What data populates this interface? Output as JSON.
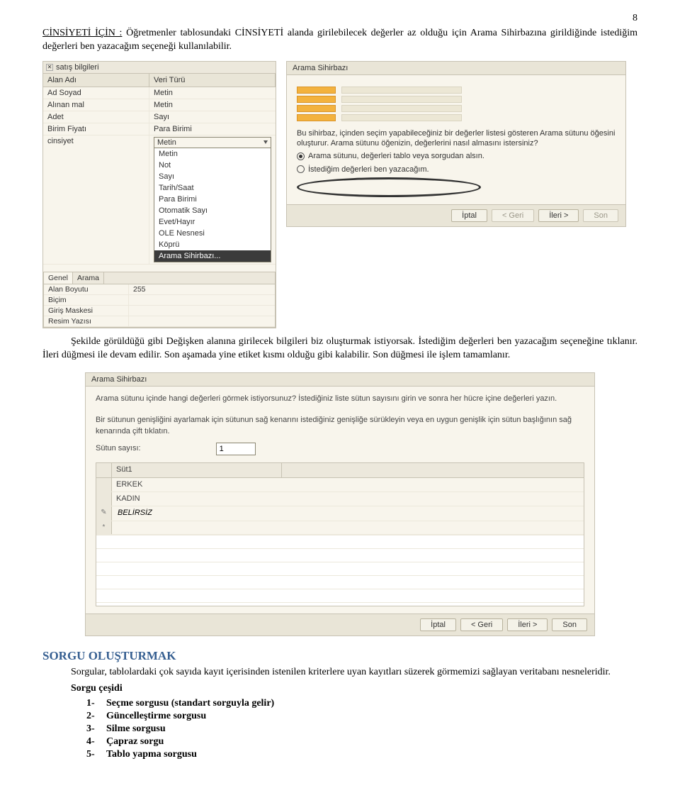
{
  "page_number": "8",
  "intro_prefix": "CİNSİYETİ İÇİN :",
  "intro_text": " Öğretmenler tablosundaki CİNSİYETİ alanda girilebilecek değerler az olduğu için Arama Sihirbazına girildiğinde istediğim değerleri ben yazacağım seçeneği kullanılabilir.",
  "mid_para": "Şekilde görüldüğü gibi Değişken alanına girilecek bilgileri biz oluşturmak istiyorsak. İstediğim değerleri ben yazacağım seçeneğine tıklanır. İleri düğmesi ile devam edilir. Son aşamada yine etiket kısmı olduğu gibi kalabilir. Son düğmesi ile işlem tamamlanır.",
  "left": {
    "tab": "satış bilgileri",
    "head_a": "Alan Adı",
    "head_b": "Veri Türü",
    "rows": [
      {
        "a": "Ad Soyad",
        "b": "Metin"
      },
      {
        "a": "Alınan mal",
        "b": "Metin"
      },
      {
        "a": "Adet",
        "b": "Sayı"
      },
      {
        "a": "Birim Fiyatı",
        "b": "Para Birimi"
      }
    ],
    "active_a": "cinsiyet",
    "active_b": "Metin",
    "dd": [
      "Metin",
      "Not",
      "Sayı",
      "Tarih/Saat",
      "Para Birimi",
      "Otomatik Sayı",
      "Evet/Hayır",
      "OLE Nesnesi",
      "Köprü",
      "Arama Sihirbazı..."
    ],
    "props_tabs": [
      "Genel",
      "Arama"
    ],
    "props": [
      [
        "Alan Boyutu",
        "255"
      ],
      [
        "Biçim",
        ""
      ],
      [
        "Giriş Maskesi",
        ""
      ],
      [
        "Resim Yazısı",
        ""
      ]
    ]
  },
  "right": {
    "title": "Arama Sihirbazı",
    "text": "Bu sihirbaz, içinden seçim yapabileceğiniz bir değerler listesi gösteren Arama sütunu öğesini oluşturur. Arama sütunu öğenizin, değerlerini nasıl almasını istersiniz?",
    "opt1": "Arama sütunu, değerleri tablo veya sorgudan alsın.",
    "opt2": "İstediğim değerleri ben yazacağım.",
    "buttons": {
      "cancel": "İptal",
      "back": "< Geri",
      "next": "İleri >",
      "finish": "Son"
    }
  },
  "wiz2": {
    "title": "Arama Sihirbazı",
    "p1": "Arama sütunu içinde hangi değerleri görmek istiyorsunuz? İstediğiniz liste sütun sayısını girin ve sonra her hücre içine değerleri yazın.",
    "p2": "Bir sütunun genişliğini ayarlamak için sütunun sağ kenarını istediğiniz genişliğe sürükleyin veya en uygun genişlik için sütun başlığının sağ kenarında çift tıklatın.",
    "count_label": "Sütun sayısı:",
    "count_value": "1",
    "col_header": "Süt1",
    "vals": [
      "ERKEK",
      "KADIN",
      "BELİRSİZ"
    ],
    "star": "*",
    "buttons": {
      "cancel": "İptal",
      "back": "< Geri",
      "next": "İleri >",
      "finish": "Son"
    }
  },
  "section_title": "SORGU OLUŞTURMAK",
  "section_para": "Sorgular, tablolardaki çok sayıda kayıt içerisinden istenilen kriterlere uyan kayıtları süzerek görmemizi sağlayan veritabanı nesneleridir.",
  "sub": "Sorgu çeşidi",
  "list": [
    "Seçme sorgusu (standart sorguyla gelir)",
    "Güncelleştirme sorgusu",
    "Silme sorgusu",
    "Çapraz sorgu",
    "Tablo yapma sorgusu"
  ]
}
